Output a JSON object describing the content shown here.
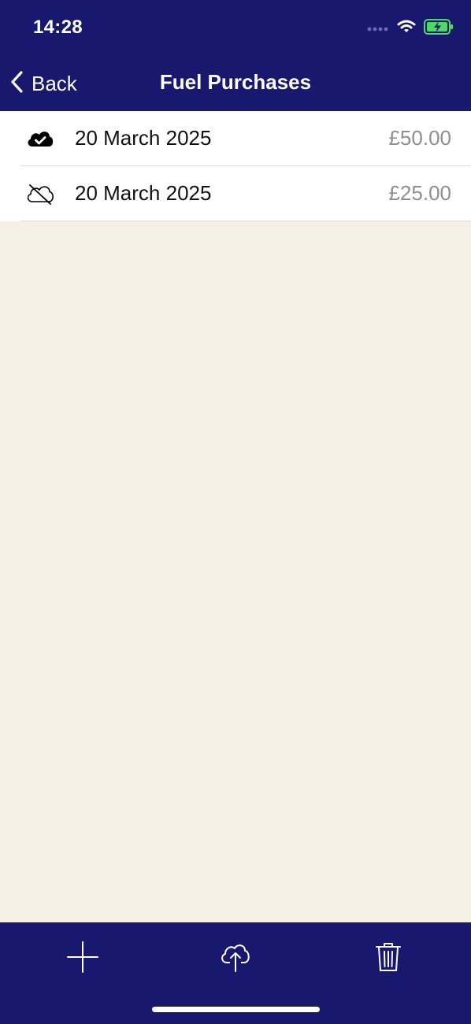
{
  "status_bar": {
    "time": "14:28"
  },
  "nav": {
    "back_label": "Back",
    "title": "Fuel Purchases"
  },
  "purchases": [
    {
      "date": "20 March 2025",
      "amount": "£50.00",
      "sync_icon": "cloud-check-icon"
    },
    {
      "date": "20 March 2025",
      "amount": "£25.00",
      "sync_icon": "cloud-slash-icon"
    }
  ],
  "toolbar": {
    "icons": [
      "plus-icon",
      "cloud-upload-icon",
      "trash-icon"
    ]
  },
  "colors": {
    "nav_background": "#18196E",
    "page_background": "#F5F0E6",
    "amount_text": "#8E8E8E",
    "battery_green": "#4CD964"
  }
}
